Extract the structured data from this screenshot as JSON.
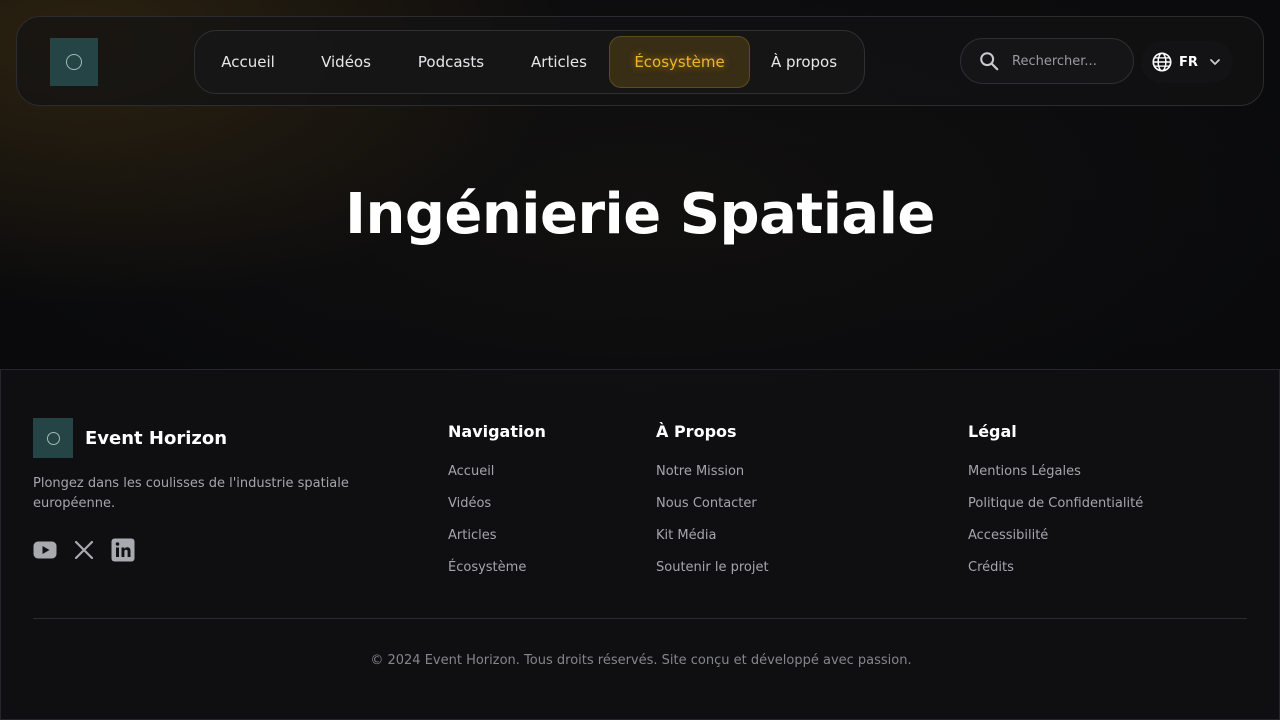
{
  "header": {
    "logo_alt": "Event Horizon logo",
    "nav": [
      {
        "label": "Accueil",
        "active": false
      },
      {
        "label": "Vidéos",
        "active": false
      },
      {
        "label": "Podcasts",
        "active": false
      },
      {
        "label": "Articles",
        "active": false
      },
      {
        "label": "Écosystème",
        "active": true
      },
      {
        "label": "À propos",
        "active": false
      }
    ],
    "search": {
      "placeholder": "Rechercher...",
      "icon": "search-icon"
    },
    "language": {
      "code": "FR",
      "icon": "globe-icon"
    }
  },
  "hero": {
    "title": "Ingénierie Spatiale"
  },
  "footer": {
    "brand": {
      "name": "Event Horizon"
    },
    "tagline": "Plongez dans les coulisses de l'industrie spatiale européenne.",
    "socials": [
      "youtube-icon",
      "x-icon",
      "linkedin-icon"
    ],
    "columns": [
      {
        "title": "Navigation",
        "links": [
          "Accueil",
          "Vidéos",
          "Articles",
          "Écosystème"
        ]
      },
      {
        "title": "À Propos",
        "links": [
          "Notre Mission",
          "Nous Contacter",
          "Kit Média",
          "Soutenir le projet"
        ]
      },
      {
        "title": "Légal",
        "links": [
          "Mentions Légales",
          "Politique de Confidentialité",
          "Accessibilité",
          "Crédits"
        ]
      }
    ],
    "copyright": "© 2024 Event Horizon. Tous droits réservés. Site conçu et développé avec passion."
  },
  "colors": {
    "accent": "#f1b62b",
    "background": "#090a0d",
    "logo_bg": "#254446",
    "muted_text": "#a5a6ac"
  }
}
